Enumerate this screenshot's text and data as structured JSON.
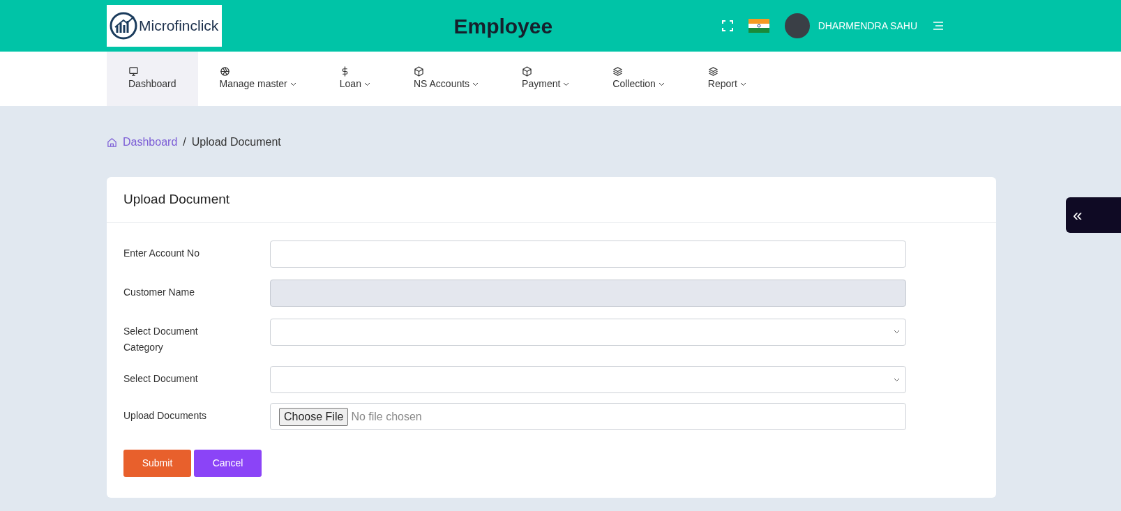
{
  "header": {
    "logo_text": "Microfinclick",
    "title": "Employee",
    "user_name": "DHARMENDRA SAHU"
  },
  "nav": [
    {
      "label": "Dashboard",
      "kind": "monitor",
      "selected": true,
      "dropdown": false
    },
    {
      "label": "Manage master",
      "kind": "aperture",
      "selected": false,
      "dropdown": true
    },
    {
      "label": "Loan",
      "kind": "dollar",
      "selected": false,
      "dropdown": true
    },
    {
      "label": "NS Accounts",
      "kind": "box",
      "selected": false,
      "dropdown": true
    },
    {
      "label": "Payment",
      "kind": "box",
      "selected": false,
      "dropdown": true
    },
    {
      "label": "Collection",
      "kind": "layers",
      "selected": false,
      "dropdown": true
    },
    {
      "label": "Report",
      "kind": "layers",
      "selected": false,
      "dropdown": true
    }
  ],
  "breadcrumb": [
    {
      "label": "Dashboard",
      "kind": "link"
    },
    {
      "label": "/",
      "kind": "separator"
    },
    {
      "label": "Upload Document",
      "kind": "current"
    }
  ],
  "card": {
    "title": "Upload Document",
    "fields": [
      {
        "label": "Enter Account No",
        "kind": "text",
        "disabled": false
      },
      {
        "label": "Customer Name",
        "kind": "text",
        "disabled": true
      },
      {
        "label": "Select Document Category",
        "kind": "select",
        "disabled": false
      },
      {
        "label": "Select Document",
        "kind": "select",
        "disabled": false
      },
      {
        "label": "Upload Documents",
        "kind": "file",
        "disabled": false,
        "button": "Choose File",
        "status": "No file chosen"
      }
    ],
    "buttons": [
      {
        "label": "Submit",
        "kind": "primary"
      },
      {
        "label": "Cancel",
        "kind": "secondary"
      }
    ]
  },
  "side_toggle": {
    "label": "«"
  }
}
